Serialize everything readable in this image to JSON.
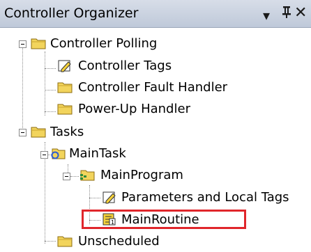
{
  "panel": {
    "title": "Controller Organizer",
    "dropdown_glyph": "▾",
    "pin_glyph": "ᵻ",
    "close_glyph": "✕"
  },
  "tree": {
    "nodes": [
      {
        "label": "Controller Polling",
        "icon": "folder-icon"
      },
      {
        "label": "Controller Tags",
        "icon": "tag-edit-icon"
      },
      {
        "label": "Controller Fault Handler",
        "icon": "folder-icon"
      },
      {
        "label": "Power-Up Handler",
        "icon": "folder-icon"
      },
      {
        "label": "Tasks",
        "icon": "folder-icon"
      },
      {
        "label": "MainTask",
        "icon": "task-folder-icon"
      },
      {
        "label": "MainProgram",
        "icon": "program-folder-icon"
      },
      {
        "label": "Parameters and Local Tags",
        "icon": "tag-edit-icon"
      },
      {
        "label": "MainRoutine",
        "icon": "routine-icon"
      },
      {
        "label": "Unscheduled",
        "icon": "folder-icon"
      }
    ]
  },
  "colors": {
    "highlight": "#e0262b",
    "folder": "#f2d45c"
  }
}
